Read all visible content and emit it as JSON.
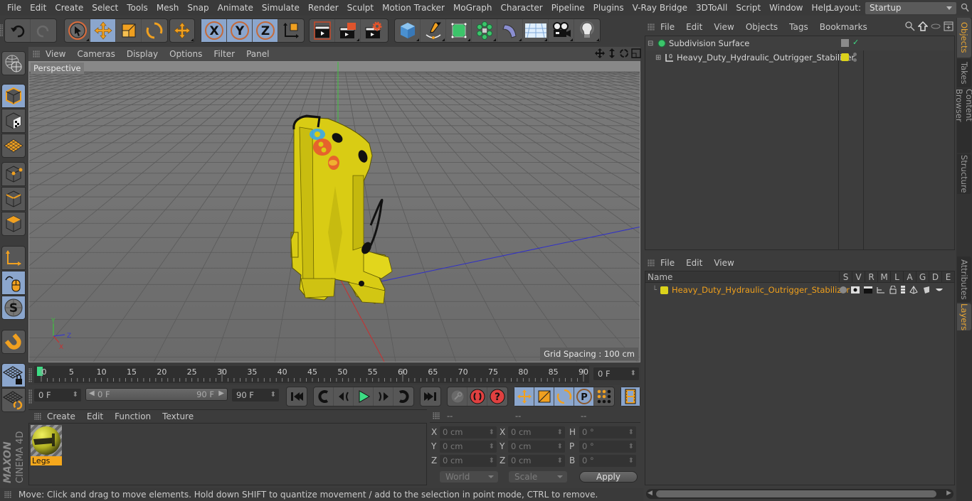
{
  "menubar": {
    "items": [
      "File",
      "Edit",
      "Create",
      "Select",
      "Tools",
      "Mesh",
      "Snap",
      "Animate",
      "Simulate",
      "Render",
      "Sculpt",
      "Motion Tracker",
      "MoGraph",
      "Character",
      "Pipeline",
      "Plugins",
      "V-Ray Bridge",
      "3DToAll",
      "Script",
      "Window",
      "Help"
    ],
    "layout_label": "Layout:",
    "layout_value": "Startup"
  },
  "toolbar": {
    "undo": "undo-icon",
    "redo": "redo-icon",
    "tools": [
      "live-selection",
      "move",
      "scale",
      "rotate",
      "move-recent"
    ],
    "axis_locks": [
      "X",
      "Y",
      "Z"
    ],
    "active_tool": "move"
  },
  "viewport": {
    "menu": [
      "View",
      "Cameras",
      "Display",
      "Options",
      "Filter",
      "Panel"
    ],
    "camera_label": "Perspective",
    "grid_spacing": "Grid Spacing : 100 cm",
    "axis_labels": {
      "x": "X",
      "y": "Y",
      "z": "Z"
    },
    "model_color": "#e2d21a"
  },
  "timeline": {
    "ticks": [
      "0",
      "5",
      "10",
      "15",
      "20",
      "25",
      "30",
      "35",
      "40",
      "45",
      "50",
      "55",
      "60",
      "65",
      "70",
      "75",
      "80",
      "85",
      "90"
    ],
    "current_frame": "0 F",
    "start_field": "0 F",
    "range_start": "0 F",
    "range_end": "90 F",
    "end_field": "90 F",
    "playhead_color": "#3ddc84"
  },
  "material_manager": {
    "menu": [
      "Create",
      "Edit",
      "Function",
      "Texture"
    ],
    "materials": [
      {
        "name": "Legs",
        "selected": true
      }
    ]
  },
  "coordinates": {
    "headers": [
      "--",
      "--",
      "--"
    ],
    "rows": [
      {
        "l1": "X",
        "v1": "0 cm",
        "l2": "X",
        "v2": "0 cm",
        "l3": "H",
        "v3": "0 °"
      },
      {
        "l1": "Y",
        "v1": "0 cm",
        "l2": "Y",
        "v2": "0 cm",
        "l3": "P",
        "v3": "0 °"
      },
      {
        "l1": "Z",
        "v1": "0 cm",
        "l2": "Z",
        "v2": "0 cm",
        "l3": "B",
        "v3": "0 °"
      }
    ],
    "space": "World",
    "mode": "Scale",
    "apply": "Apply"
  },
  "status_bar": "Move: Click and drag to move elements. Hold down SHIFT to quantize movement / add to the selection in point mode, CTRL to remove.",
  "object_manager": {
    "menu": [
      "File",
      "Edit",
      "View",
      "Objects",
      "Tags",
      "Bookmarks"
    ],
    "objects": [
      {
        "name": "Subdivision Surface",
        "type": "subdivision"
      },
      {
        "name": "Heavy_Duty_Hydraulic_Outrigger_Stabilizer",
        "type": "null",
        "layer_color": "#dbd21b"
      }
    ]
  },
  "layer_manager": {
    "menu": [
      "File",
      "Edit",
      "View"
    ],
    "columns": [
      "Name",
      "S",
      "V",
      "R",
      "M",
      "L",
      "A",
      "G",
      "D",
      "E"
    ],
    "layers": [
      {
        "name": "Heavy_Duty_Hydraulic_Outrigger_Stabilizer",
        "color": "#dbd21b"
      }
    ]
  },
  "side_tabs": {
    "top": [
      {
        "label": "Objects",
        "active": true
      },
      {
        "label": "Takes",
        "active": false
      },
      {
        "label": "Content Browser",
        "active": false
      },
      {
        "label": "Structure",
        "active": false
      }
    ],
    "bottom": [
      {
        "label": "Attributes",
        "active": false
      },
      {
        "label": "Layers",
        "active": true
      }
    ]
  },
  "branding": {
    "line1": "MAXON",
    "line2": "CINEMA 4D"
  }
}
